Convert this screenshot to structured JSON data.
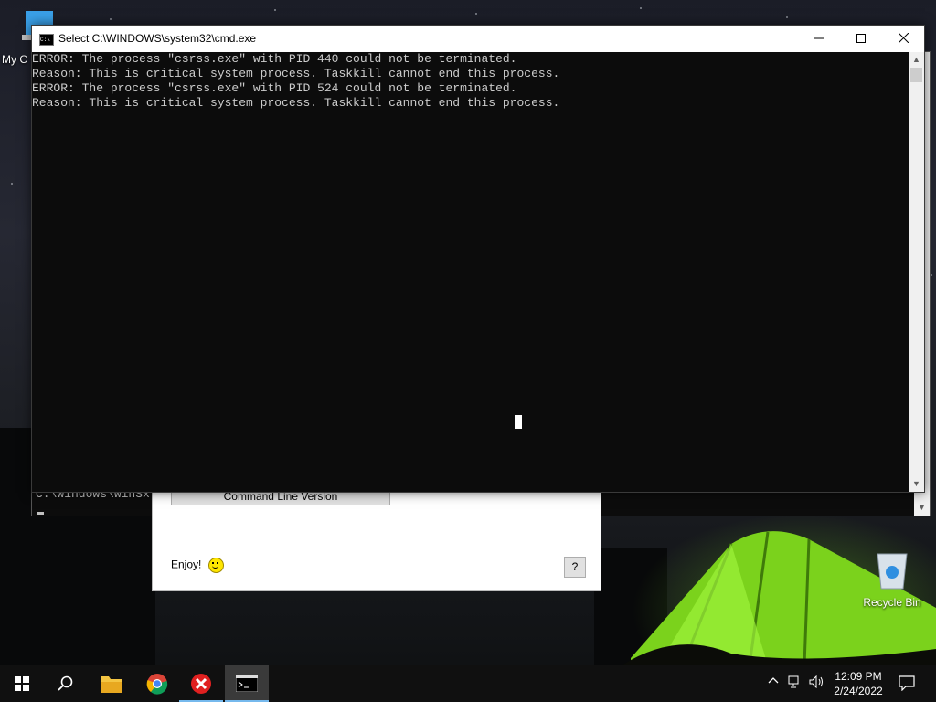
{
  "desktop": {
    "icons": [
      {
        "label": "My C"
      },
      {
        "label": "Recycle Bin"
      }
    ]
  },
  "background_console": {
    "text": "C:\\Windows\\WinSx"
  },
  "dialog": {
    "cmdline_button": "Command Line Version",
    "enjoy": "Enjoy!",
    "help": "?"
  },
  "cmd_window": {
    "title": "Select C:\\WINDOWS\\system32\\cmd.exe",
    "icon_text": "C:\\",
    "lines": [
      "ERROR: The process \"csrss.exe\" with PID 440 could not be terminated.",
      "Reason: This is critical system process. Taskkill cannot end this process.",
      "ERROR: The process \"csrss.exe\" with PID 524 could not be terminated.",
      "Reason: This is critical system process. Taskkill cannot end this process."
    ]
  },
  "taskbar": {
    "time": "12:09 PM",
    "date": "2/24/2022",
    "items": [
      {
        "name": "start-icon"
      },
      {
        "name": "search-icon"
      },
      {
        "name": "file-explorer-icon"
      },
      {
        "name": "chrome-icon"
      },
      {
        "name": "x-app-icon"
      },
      {
        "name": "cmd-icon"
      }
    ]
  }
}
